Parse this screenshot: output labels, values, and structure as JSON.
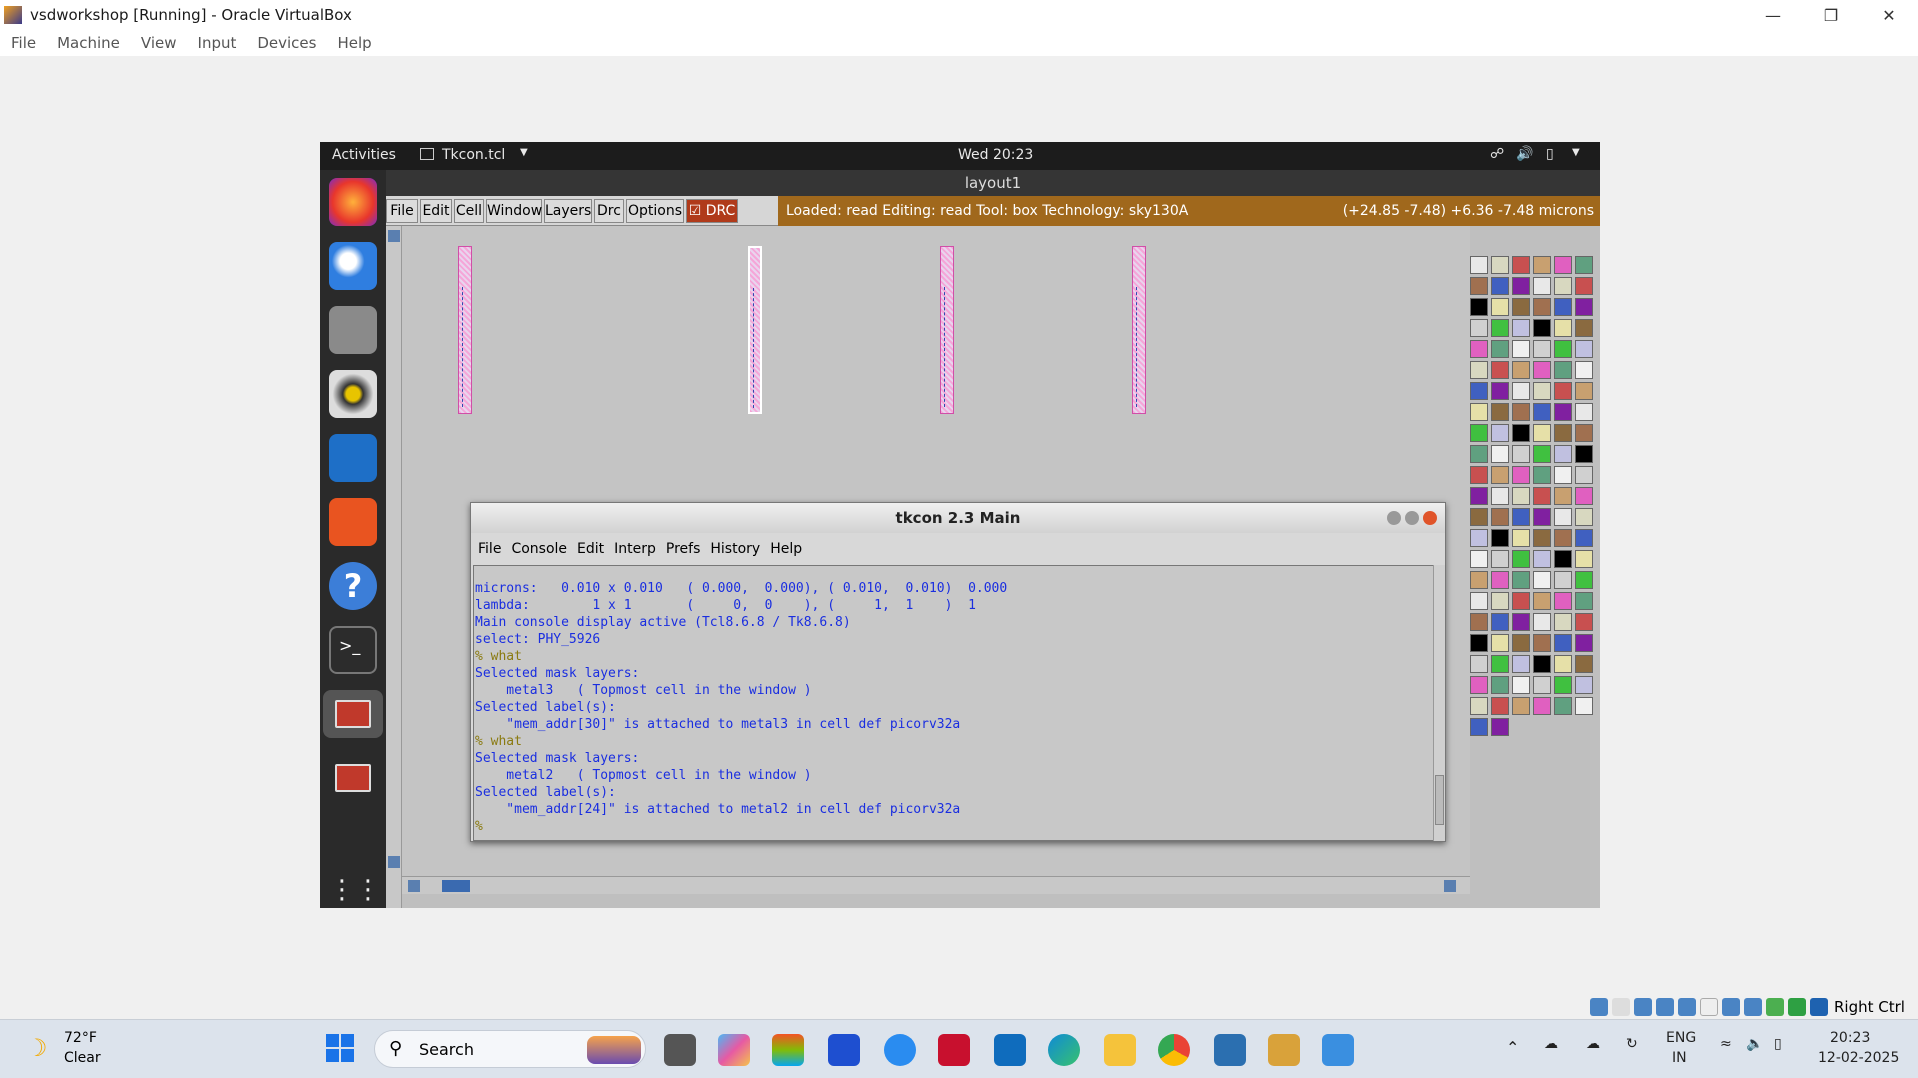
{
  "vbox": {
    "title": "vsdworkshop [Running] - Oracle VirtualBox",
    "menu": [
      "File",
      "Machine",
      "View",
      "Input",
      "Devices",
      "Help"
    ],
    "status_right": "Right Ctrl"
  },
  "ubuntu": {
    "activities": "Activities",
    "app": "Tkcon.tcl",
    "clock": "Wed 20:23",
    "dock_icons": [
      "firefox-icon",
      "thunderbird-icon",
      "files-icon",
      "rhythmbox-icon",
      "writer-icon",
      "software-icon",
      "help-icon",
      "terminal-icon",
      "magic-icon",
      "magic-icon-2",
      "apps-grid-icon"
    ]
  },
  "magic": {
    "window_title": "layout1",
    "menu": [
      "File",
      "Edit",
      "Cell",
      "Window",
      "Layers",
      "Drc",
      "Options"
    ],
    "drc_label": "DRC",
    "status": "Loaded: read Editing: read Tool: box  Technology: sky130A",
    "coords": "(+24.85 -7.48) +6.36 -7.48 microns"
  },
  "tkcon": {
    "title": "tkcon 2.3 Main",
    "menu": [
      "File",
      "Console",
      "Edit",
      "Interp",
      "Prefs",
      "History",
      "Help"
    ],
    "lines": [
      "microns:   0.010 x 0.010   ( 0.000,  0.000), ( 0.010,  0.010)  0.000",
      "lambda:        1 x 1       (     0,  0    ), (     1,  1    )  1",
      "Main console display active (Tcl8.6.8 / Tk8.6.8)",
      "select: PHY_5926",
      "% what",
      "Selected mask layers:",
      "    metal3   ( Topmost cell in the window )",
      "Selected label(s):",
      "    \"mem_addr[30]\" is attached to metal3 in cell def picorv32a",
      "% what",
      "Selected mask layers:",
      "    metal2   ( Topmost cell in the window )",
      "Selected label(s):",
      "    \"mem_addr[24]\" is attached to metal2 in cell def picorv32a",
      "% "
    ]
  },
  "taskbar": {
    "weather_temp": "72°F",
    "weather_desc": "Clear",
    "search": "Search",
    "lang1": "ENG",
    "lang2": "IN",
    "time": "20:23",
    "date": "12-02-2025"
  }
}
